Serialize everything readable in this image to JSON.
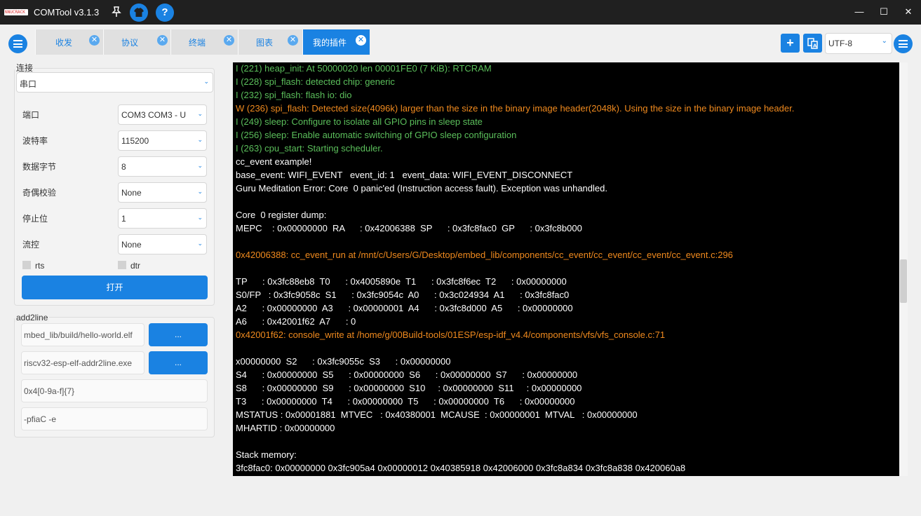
{
  "window": {
    "logo_text": "NNUCRACK",
    "title": "COMTool v3.1.3",
    "help_symbol": "?",
    "minimize_symbol": "—",
    "maximize_symbol": "☐",
    "close_symbol": "✕"
  },
  "tabs": [
    {
      "label": "收发",
      "active": false
    },
    {
      "label": "协议",
      "active": false
    },
    {
      "label": "终端",
      "active": false
    },
    {
      "label": "图表",
      "active": false
    },
    {
      "label": "我的插件",
      "active": true
    }
  ],
  "toolbar": {
    "add_symbol": "+",
    "encoding": "UTF-8"
  },
  "connection": {
    "group_title": "连接",
    "type": "串口",
    "fields": [
      {
        "label": "端口",
        "value": "COM3 COM3 - U"
      },
      {
        "label": "波特率",
        "value": "115200"
      },
      {
        "label": "数据字节",
        "value": "8"
      },
      {
        "label": "奇偶校验",
        "value": "None"
      },
      {
        "label": "停止位",
        "value": "1"
      },
      {
        "label": "流控",
        "value": "None"
      }
    ],
    "rts_label": "rts",
    "dtr_label": "dtr",
    "open_button": "打开"
  },
  "addr2line": {
    "group_title": "add2line",
    "elf_path": "mbed_lib/build/hello-world.elf",
    "addr2line_path": "riscv32-esp-elf-addr2line.exe",
    "browse_label": "...",
    "regex": "0x4[0-9a-f]{7}",
    "args": "-pfiaC -e"
  },
  "terminal": {
    "lines": [
      {
        "c": "g",
        "t": "I (221) heap_init: At 50000020 len 00001FE0 (7 KiB): RTCRAM"
      },
      {
        "c": "g",
        "t": "I (228) spi_flash: detected chip: generic"
      },
      {
        "c": "g",
        "t": "I (232) spi_flash: flash io: dio"
      },
      {
        "c": "o",
        "t": "W (236) spi_flash: Detected size(4096k) larger than the size in the binary image header(2048k). Using the size in the binary image header."
      },
      {
        "c": "g",
        "t": "I (249) sleep: Configure to isolate all GPIO pins in sleep state"
      },
      {
        "c": "g",
        "t": "I (256) sleep: Enable automatic switching of GPIO sleep configuration"
      },
      {
        "c": "g",
        "t": "I (263) cpu_start: Starting scheduler."
      },
      {
        "c": "w",
        "t": "cc_event example!"
      },
      {
        "c": "w",
        "t": "base_event: WIFI_EVENT   event_id: 1   event_data: WIFI_EVENT_DISCONNECT"
      },
      {
        "c": "w",
        "t": "Guru Meditation Error: Core  0 panic'ed (Instruction access fault). Exception was unhandled."
      },
      {
        "c": "w",
        "t": ""
      },
      {
        "c": "w",
        "t": "Core  0 register dump:"
      },
      {
        "c": "w",
        "t": "MEPC    : 0x00000000  RA      : 0x42006388  SP      : 0x3fc8fac0  GP      : 0x3fc8b000"
      },
      {
        "c": "w",
        "t": ""
      },
      {
        "c": "o",
        "t": "0x42006388: cc_event_run at /mnt/c/Users/G/Desktop/embed_lib/components/cc_event/cc_event/cc_event/cc_event.c:296"
      },
      {
        "c": "w",
        "t": ""
      },
      {
        "c": "w",
        "t": "TP      : 0x3fc88eb8  T0      : 0x4005890e  T1      : 0x3fc8f6ec  T2      : 0x00000000"
      },
      {
        "c": "w",
        "t": "S0/FP   : 0x3fc9058c  S1      : 0x3fc9054c  A0      : 0x3c024934  A1      : 0x3fc8fac0"
      },
      {
        "c": "w",
        "t": "A2      : 0x00000000  A3      : 0x00000001  A4      : 0x3fc8d000  A5      : 0x00000000"
      },
      {
        "c": "w",
        "t": "A6      : 0x42001f62  A7      : 0"
      },
      {
        "c": "o",
        "t": "0x42001f62: console_write at /home/g/00Build-tools/01ESP/esp-idf_v4.4/components/vfs/vfs_console.c:71"
      },
      {
        "c": "w",
        "t": ""
      },
      {
        "c": "w",
        "t": "x00000000  S2      : 0x3fc9055c  S3      : 0x00000000"
      },
      {
        "c": "w",
        "t": "S4      : 0x00000000  S5      : 0x00000000  S6      : 0x00000000  S7      : 0x00000000"
      },
      {
        "c": "w",
        "t": "S8      : 0x00000000  S9      : 0x00000000  S10     : 0x00000000  S11     : 0x00000000"
      },
      {
        "c": "w",
        "t": "T3      : 0x00000000  T4      : 0x00000000  T5      : 0x00000000  T6      : 0x00000000"
      },
      {
        "c": "w",
        "t": "MSTATUS : 0x00001881  MTVEC   : 0x40380001  MCAUSE  : 0x00000001  MTVAL   : 0x00000000"
      },
      {
        "c": "w",
        "t": "MHARTID : 0x00000000"
      },
      {
        "c": "w",
        "t": ""
      },
      {
        "c": "w",
        "t": "Stack memory:"
      },
      {
        "c": "w",
        "t": "3fc8fac0: 0x00000000 0x3fc905a4 0x00000012 0x40385918 0x42006000 0x3fc8a834 0x3fc8a838 0x420060a8"
      }
    ]
  },
  "colors": {
    "accent": "#1a82e2",
    "titlebar": "#202020",
    "terminal_bg": "#000000",
    "info_text": "#5bbf5b",
    "warning_text": "#f08a1e",
    "plain_text": "#ffffff"
  }
}
